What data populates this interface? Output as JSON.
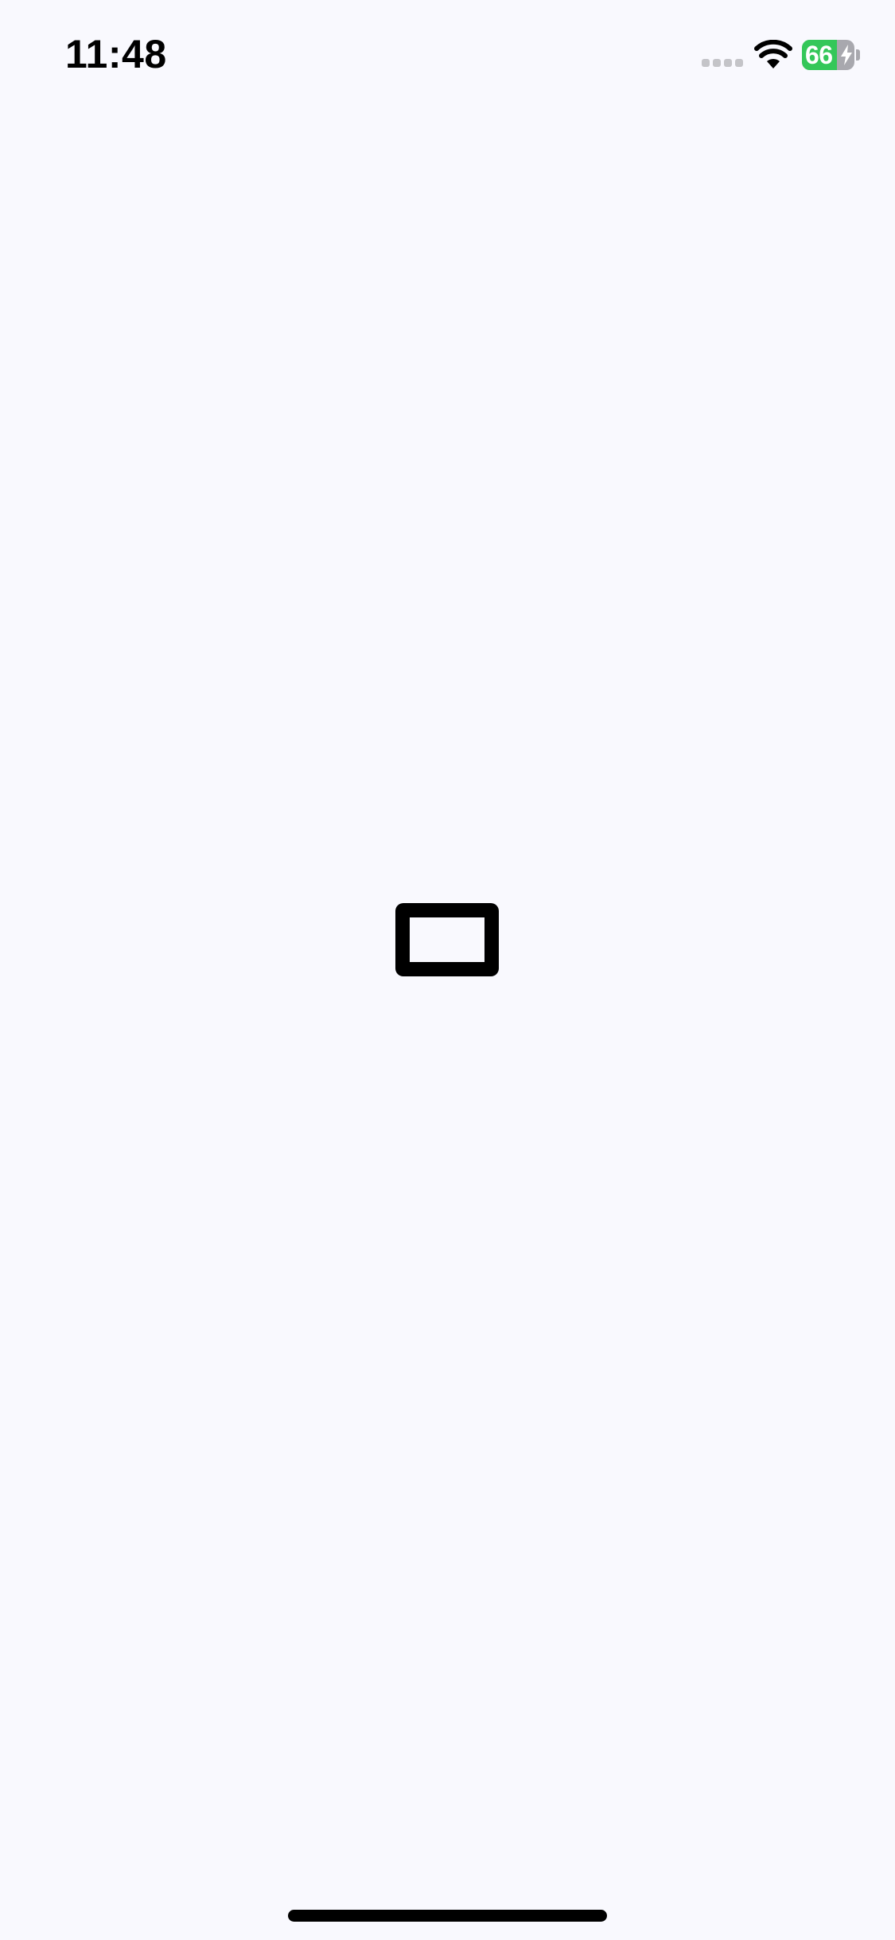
{
  "status_bar": {
    "time": "11:48",
    "battery": {
      "percent_text": "66",
      "level": 0.66,
      "charging": true,
      "fill_color": "#34C759",
      "empty_color": "#A8A8AE"
    },
    "icons": {
      "signal": "cellular-signal-icon",
      "wifi": "wifi-icon",
      "battery": "battery-icon",
      "charging": "lightning-bolt-icon"
    }
  },
  "colors": {
    "background": "#F9F9FE",
    "foreground": "#000000"
  },
  "main": {
    "indicator_icon": "rectangle-outline-icon"
  }
}
